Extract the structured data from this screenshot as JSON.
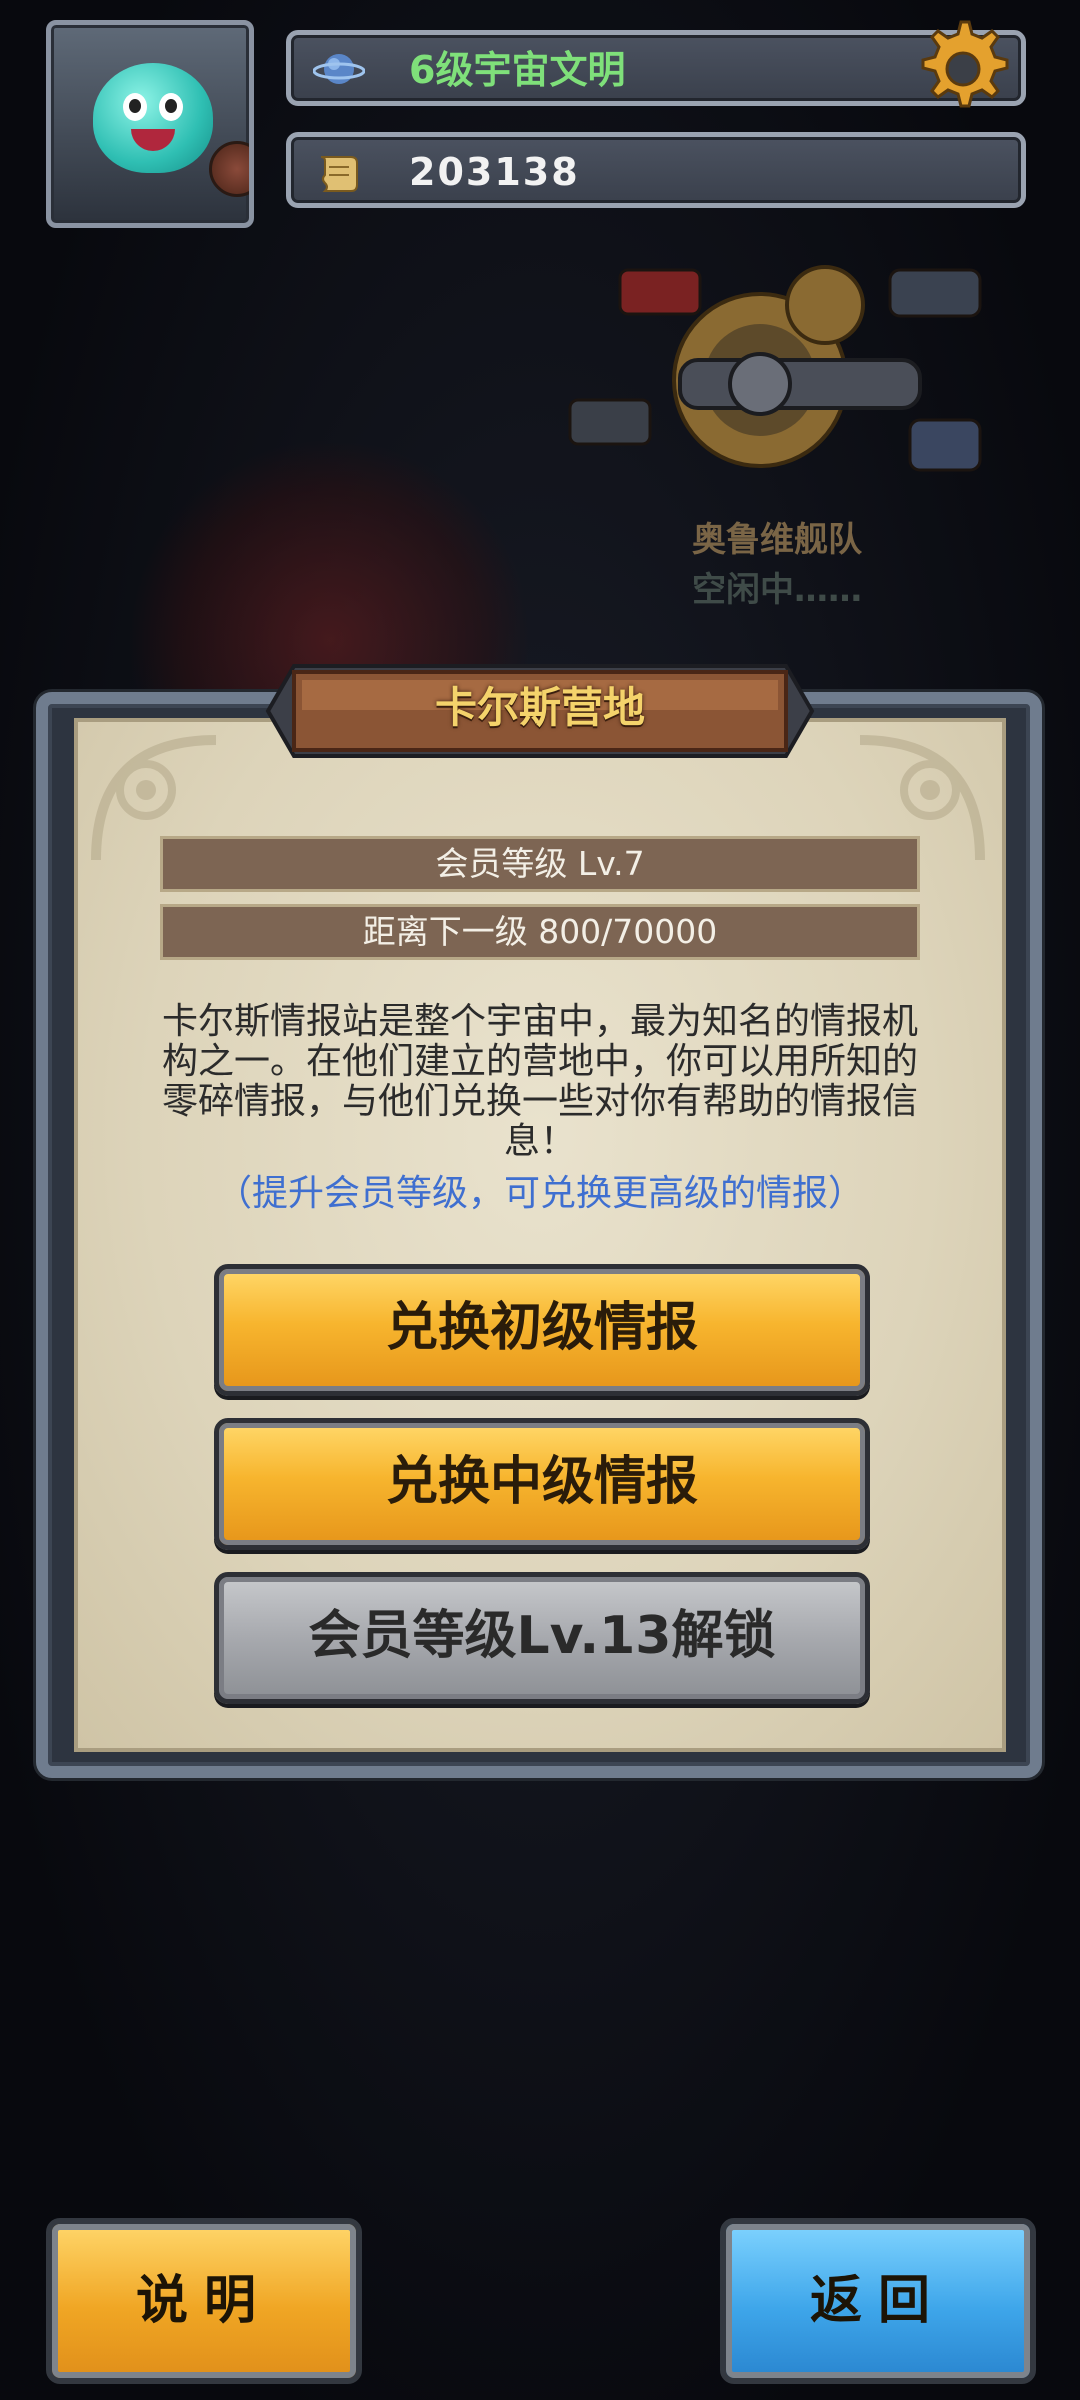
{
  "player": {
    "civilization_level": "6级宇宙文明",
    "intel_count": "203138"
  },
  "fleet": {
    "name": "奥鲁维舰队",
    "status": "空闲中……"
  },
  "panel": {
    "title": "卡尔斯营地",
    "member_level": "会员等级 Lv.7",
    "next_level_progress": "距离下一级 800/70000",
    "description": "卡尔斯情报站是整个宇宙中，最为知名的情报机构之一。在他们建立的营地中，你可以用所知的零碎情报，与他们兑换一些对你有帮助的情报信息！",
    "hint": "（提升会员等级，可兑换更高级的情报）"
  },
  "buttons": {
    "exchange_basic": "兑换初级情报",
    "exchange_intermediate": "兑换中级情报",
    "locked_advanced": "会员等级Lv.13解锁",
    "help": "说明",
    "back": "返回"
  },
  "colors": {
    "civ_text": "#7fe07a",
    "hint_text": "#3f6fd0",
    "gold_button": "#f7b52e",
    "blue_button": "#3ea6ea",
    "gray_button": "#a7a9ae"
  },
  "icons": {
    "settings": "gear-icon",
    "civilization": "planet-icon",
    "intel": "scroll-icon"
  }
}
